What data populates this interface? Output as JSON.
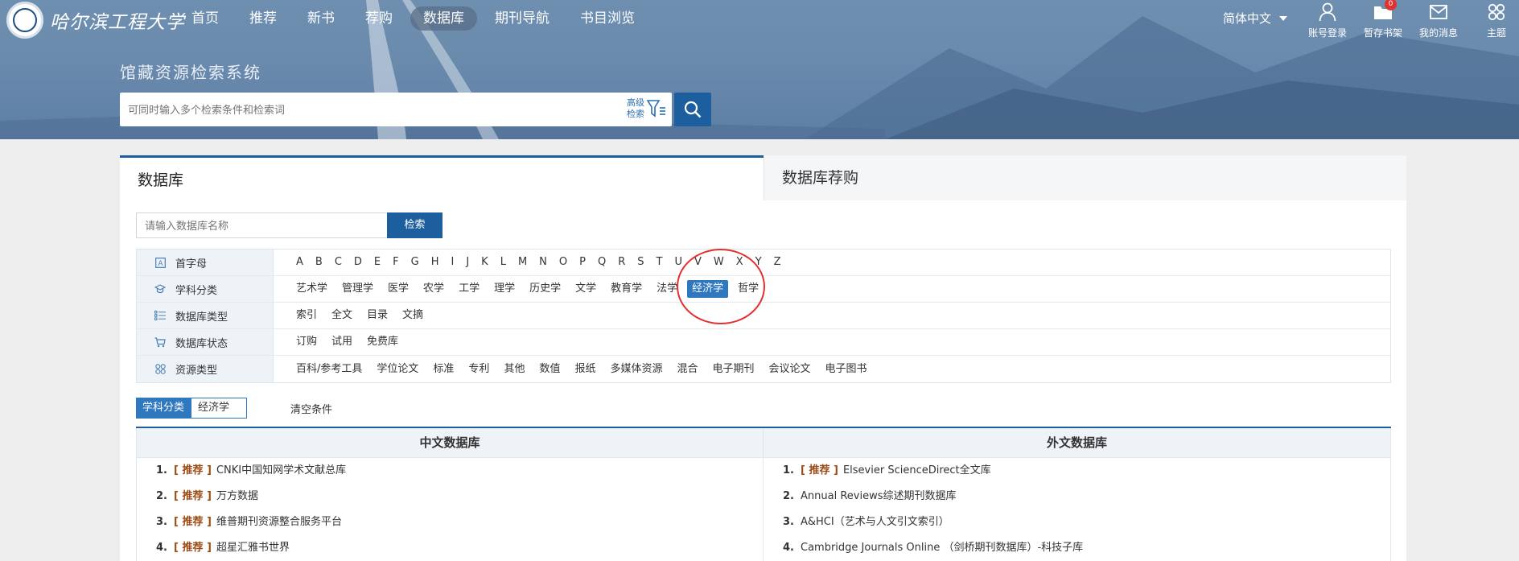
{
  "header": {
    "logo_text": "哈尔滨工程大学",
    "nav": [
      "首页",
      "推荐",
      "新书",
      "荐购",
      "数据库",
      "期刊导航",
      "书目浏览"
    ],
    "nav_active_index": 4,
    "language": "简体中文",
    "tools": [
      {
        "label": "账号登录",
        "icon": "user-icon"
      },
      {
        "label": "暂存书架",
        "icon": "folder-icon",
        "badge": "0"
      },
      {
        "label": "我的消息",
        "icon": "mail-icon"
      },
      {
        "label": "主题",
        "icon": "theme-icon"
      }
    ],
    "site_title": "馆藏资源检索系统",
    "search_placeholder": "可同时输入多个检索条件和检索词",
    "advanced_label_1": "高级",
    "advanced_label_2": "检索"
  },
  "tabs": {
    "database": "数据库",
    "recommend": "数据库荐购"
  },
  "db_search": {
    "placeholder": "请输入数据库名称",
    "button": "检索"
  },
  "filters": [
    {
      "head": "首字母",
      "icon": "letter-icon",
      "items": [
        "A",
        "B",
        "C",
        "D",
        "E",
        "F",
        "G",
        "H",
        "I",
        "J",
        "K",
        "L",
        "M",
        "N",
        "O",
        "P",
        "Q",
        "R",
        "S",
        "T",
        "U",
        "V",
        "W",
        "X",
        "Y",
        "Z"
      ]
    },
    {
      "head": "学科分类",
      "icon": "graduation-cap-icon",
      "items": [
        "艺术学",
        "管理学",
        "医学",
        "农学",
        "工学",
        "理学",
        "历史学",
        "文学",
        "教育学",
        "法学",
        "经济学",
        "哲学"
      ],
      "selected": "经济学"
    },
    {
      "head": "数据库类型",
      "icon": "list-icon",
      "items": [
        "索引",
        "全文",
        "目录",
        "文摘"
      ]
    },
    {
      "head": "数据库状态",
      "icon": "cart-icon",
      "items": [
        "订购",
        "试用",
        "免费库"
      ]
    },
    {
      "head": "资源类型",
      "icon": "grid-icon",
      "items": [
        "百科/参考工具",
        "学位论文",
        "标准",
        "专利",
        "其他",
        "数值",
        "报纸",
        "多媒体资源",
        "混合",
        "电子期刊",
        "会议论文",
        "电子图书"
      ]
    }
  ],
  "condition": {
    "key": "学科分类",
    "value": "经济学",
    "clear": "清空条件"
  },
  "lists": {
    "chinese": {
      "title": "中文数据库",
      "items": [
        {
          "num": "1.",
          "tag": "[ 推荐 ]",
          "name": "CNKI中国知网学术文献总库"
        },
        {
          "num": "2.",
          "tag": "[ 推荐 ]",
          "name": "万方数据"
        },
        {
          "num": "3.",
          "tag": "[ 推荐 ]",
          "name": "维普期刊资源整合服务平台"
        },
        {
          "num": "4.",
          "tag": "[ 推荐 ]",
          "name": "超星汇雅书世界"
        }
      ]
    },
    "foreign": {
      "title": "外文数据库",
      "items": [
        {
          "num": "1.",
          "tag": "[ 推荐 ]",
          "name": "Elsevier ScienceDirect全文库"
        },
        {
          "num": "2.",
          "tag": "",
          "name": "Annual Reviews综述期刊数据库"
        },
        {
          "num": "3.",
          "tag": "",
          "name": "A&HCI（艺术与人文引文索引）"
        },
        {
          "num": "4.",
          "tag": "",
          "name": "Cambridge Journals Online （剑桥期刊数据库）-科技子库"
        }
      ]
    }
  }
}
